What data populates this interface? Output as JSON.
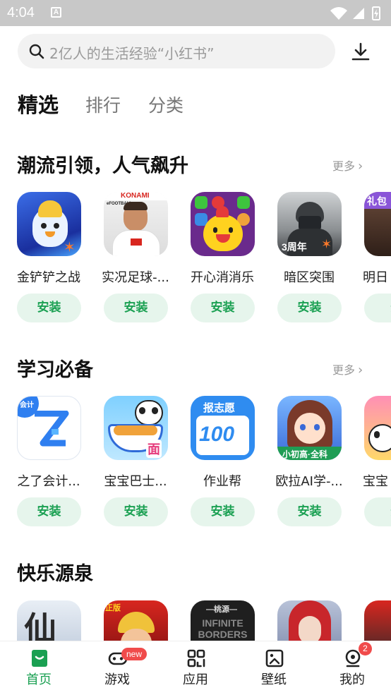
{
  "status_bar": {
    "time": "4:04",
    "notification_glyph": "A"
  },
  "search": {
    "placeholder": "2亿人的生活经验“小红书”"
  },
  "tabs": [
    {
      "label": "精选",
      "active": true
    },
    {
      "label": "排行",
      "active": false
    },
    {
      "label": "分类",
      "active": false
    }
  ],
  "sections": [
    {
      "title": "潮流引领，人气飙升",
      "more": "更多",
      "apps": [
        {
          "name": "金铲铲之战",
          "install": "安装",
          "icon": "penguin-game-icon"
        },
        {
          "name": "实况足球-...",
          "install": "安装",
          "icon": "football-player-icon",
          "icon_text_top": "KONAMI",
          "icon_text_small": "eFOOTBALL"
        },
        {
          "name": "开心消消乐",
          "install": "安装",
          "icon": "chick-puzzle-icon"
        },
        {
          "name": "暗区突围",
          "install": "安装",
          "icon": "soldier-icon",
          "icon_text": "3周年"
        },
        {
          "name": "明日",
          "install": "安",
          "icon": "partial-game-icon",
          "icon_text": "礼包"
        }
      ]
    },
    {
      "title": "学习必备",
      "more": "更多",
      "apps": [
        {
          "name": "之了会计...",
          "install": "安装",
          "icon": "zhile-z-icon",
          "icon_text": "会计"
        },
        {
          "name": "宝宝巴士...",
          "install": "安装",
          "icon": "panda-noodles-icon",
          "icon_text": "面"
        },
        {
          "name": "作业帮",
          "install": "安装",
          "icon": "homework-100-icon",
          "icon_text_top": "报志愿",
          "icon_text": "100"
        },
        {
          "name": "欧拉AI学-...",
          "install": "安装",
          "icon": "anime-girl-icon",
          "icon_text": "小初高·全科"
        },
        {
          "name": "宝宝",
          "install": "安",
          "icon": "panda-kids-icon"
        }
      ]
    },
    {
      "title": "快乐源泉",
      "apps": [
        {
          "icon": "xian-game-icon",
          "icon_text": "仙"
        },
        {
          "icon": "pirate-anime-icon",
          "icon_text": "正版"
        },
        {
          "icon": "infinite-borders-icon",
          "icon_text_top": "—桃源—",
          "icon_text": "INFINITE BORDERS"
        },
        {
          "icon": "red-hood-icon"
        },
        {
          "icon": "racing-icon"
        }
      ]
    }
  ],
  "bottom_nav": [
    {
      "label": "首页",
      "icon": "home-icon",
      "active": true
    },
    {
      "label": "游戏",
      "icon": "gamepad-icon",
      "active": false,
      "badge": "new"
    },
    {
      "label": "应用",
      "icon": "apps-grid-icon",
      "active": false
    },
    {
      "label": "壁纸",
      "icon": "wallpaper-icon",
      "active": false
    },
    {
      "label": "我的",
      "icon": "profile-icon",
      "active": false,
      "badge": "2"
    }
  ],
  "colors": {
    "accent": "#1aa052",
    "install_bg": "#e6f5ec",
    "badge": "#f04b4b",
    "status_bar": "#c8c8c8"
  }
}
